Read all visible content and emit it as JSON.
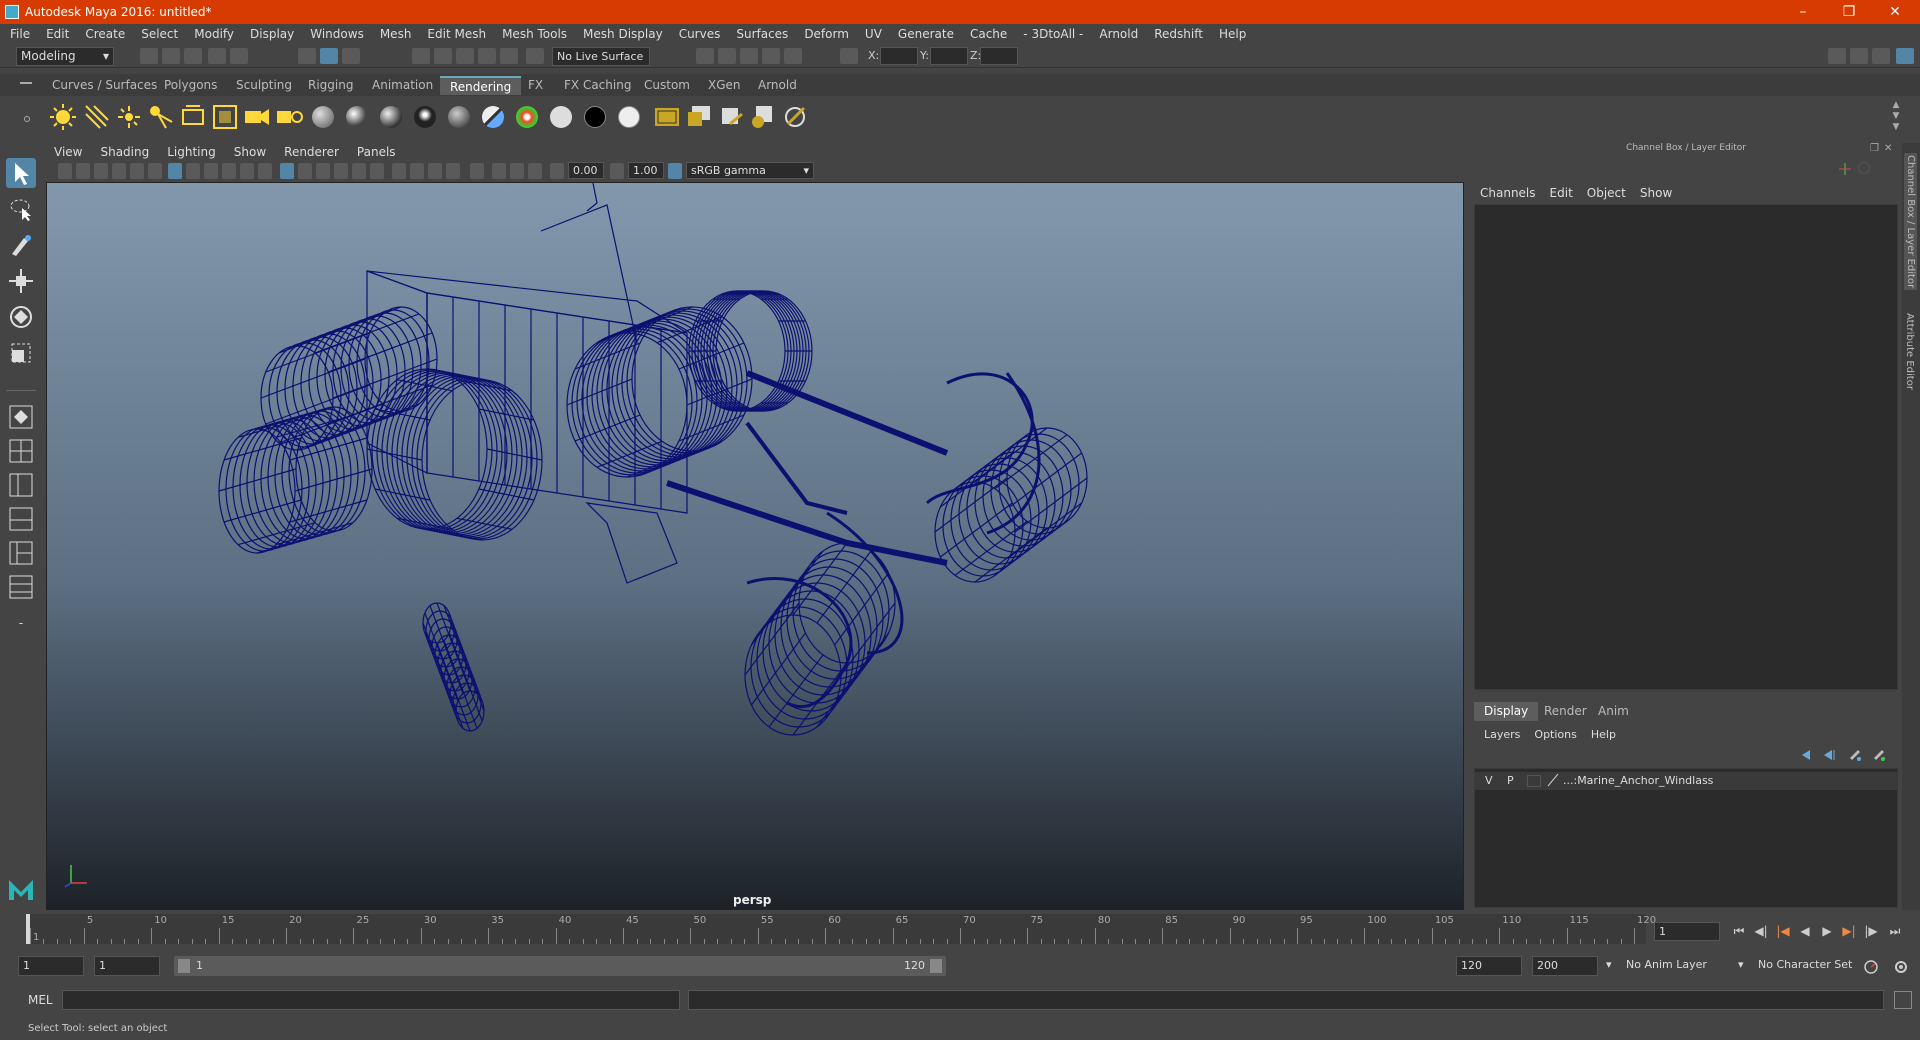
{
  "window": {
    "title": "Autodesk Maya 2016: untitled*"
  },
  "menubar": [
    "File",
    "Edit",
    "Create",
    "Select",
    "Modify",
    "Display",
    "Windows",
    "Mesh",
    "Edit Mesh",
    "Mesh Tools",
    "Mesh Display",
    "Curves",
    "Surfaces",
    "Deform",
    "UV",
    "Generate",
    "Cache",
    "- 3DtoAll -",
    "Arnold",
    "Redshift",
    "Help"
  ],
  "statusline": {
    "mode": "Modeling",
    "live_surface": "No Live Surface",
    "x_label": "X:",
    "y_label": "Y:",
    "z_label": "Z:"
  },
  "shelf_tabs": [
    "Curves / Surfaces",
    "Polygons",
    "Sculpting",
    "Rigging",
    "Animation",
    "Rendering",
    "FX",
    "FX Caching",
    "Custom",
    "XGen",
    "Arnold"
  ],
  "shelf_active_tab": "Rendering",
  "viewport": {
    "menu": [
      "View",
      "Shading",
      "Lighting",
      "Show",
      "Renderer",
      "Panels"
    ],
    "exposure": "0.00",
    "gamma": "1.00",
    "color_space": "sRGB gamma",
    "camera_label": "persp",
    "wire_color": "#0c1070"
  },
  "channel_box": {
    "title": "Channel Box / Layer Editor",
    "menu": [
      "Channels",
      "Edit",
      "Object",
      "Show"
    ],
    "tabs": [
      "Display",
      "Render",
      "Anim"
    ],
    "active_tab": "Display",
    "layer_menu": [
      "Layers",
      "Options",
      "Help"
    ],
    "layers": [
      {
        "v": "V",
        "p": "P",
        "name": "...:Marine_Anchor_Windlass"
      }
    ],
    "side_tabs": [
      "Channel Box / Layer Editor",
      "Attribute Editor"
    ]
  },
  "timeline": {
    "ticks": [
      1,
      5,
      10,
      15,
      20,
      25,
      30,
      35,
      40,
      45,
      50,
      55,
      60,
      65,
      70,
      75,
      80,
      85,
      90,
      95,
      100,
      105,
      110,
      115,
      120
    ],
    "current_frame": "1"
  },
  "range": {
    "start": "1",
    "inner_start": "1",
    "slider_start": "1",
    "slider_end": "120",
    "end": "120",
    "outer_end": "200",
    "anim_layer": "No Anim Layer",
    "character_set": "No Character Set"
  },
  "command": {
    "label": "MEL"
  },
  "help_line": "Select Tool: select an object"
}
